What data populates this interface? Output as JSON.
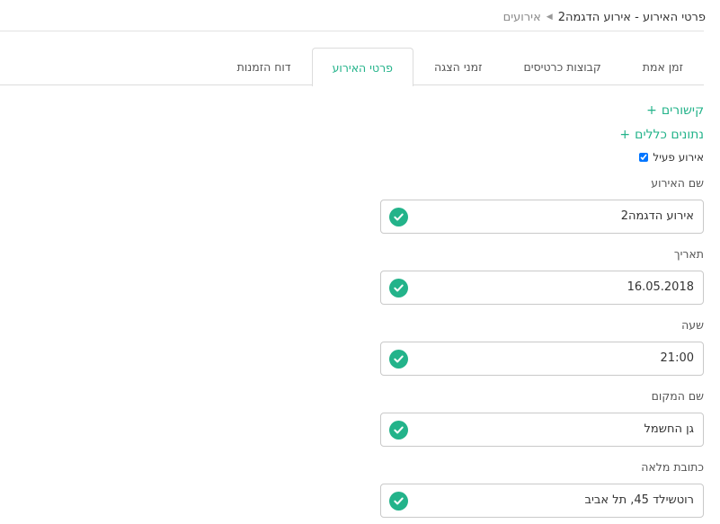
{
  "breadcrumb": {
    "parent": "אירועים",
    "separator": "◀",
    "current": "פרטי האירוע - אירוע הדגמה2"
  },
  "tabs": [
    {
      "label": "דוח הזמנות",
      "active": false
    },
    {
      "label": "פרטי האירוע",
      "active": true
    },
    {
      "label": "זמני הצגה",
      "active": false
    },
    {
      "label": "קבוצות כרטיסים",
      "active": false
    },
    {
      "label": "זמן אמת",
      "active": false
    }
  ],
  "sections": {
    "links": "קישורים",
    "general": "נתונים כללים",
    "plus": "+"
  },
  "active_checkbox": {
    "label": "אירוע פעיל",
    "checked": true
  },
  "fields": [
    {
      "label": "שם האירוע",
      "value": "אירוע הדגמה2"
    },
    {
      "label": "תאריך",
      "value": "16.05.2018"
    },
    {
      "label": "שעה",
      "value": "21:00"
    },
    {
      "label": "שם המקום",
      "value": "גן החשמל"
    },
    {
      "label": "כתובת מלאה",
      "value": "רוטשילד 45, תל אביב"
    }
  ],
  "colors": {
    "accent": "#23b38a",
    "border": "#c9c9c9"
  },
  "icons": {
    "valid": "check-circle-icon",
    "separator": "caret-left-icon"
  }
}
